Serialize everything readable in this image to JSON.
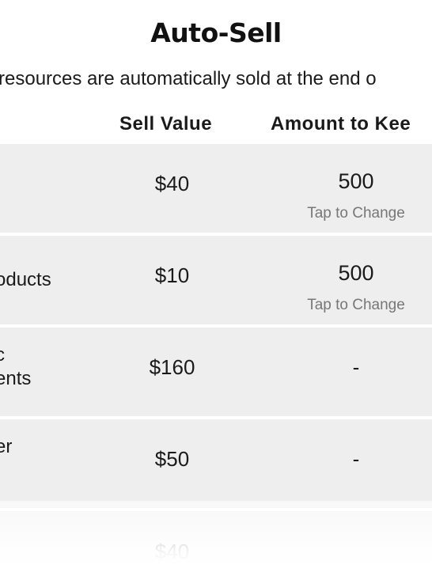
{
  "title": "Auto-Sell",
  "subtitle": "h resources are automatically sold at the end o",
  "columns": {
    "sell_value": "Sell Value",
    "amount_to_keep": "Amount to Kee"
  },
  "rows": [
    {
      "name_lines": [
        "",
        ""
      ],
      "sell_value": "$40",
      "keep": "500",
      "hint": "Tap to Change"
    },
    {
      "name_lines": [
        "oducts",
        ""
      ],
      "sell_value": "$10",
      "keep": "500",
      "hint": "Tap to Change"
    },
    {
      "name_lines": [
        "c",
        "ents"
      ],
      "sell_value": "$160",
      "keep": "-"
    },
    {
      "name_lines": [
        "er",
        ""
      ],
      "sell_value": "$50",
      "keep": "-"
    },
    {
      "name_lines": [
        "",
        ""
      ],
      "sell_value": "$40",
      "keep": ""
    }
  ]
}
